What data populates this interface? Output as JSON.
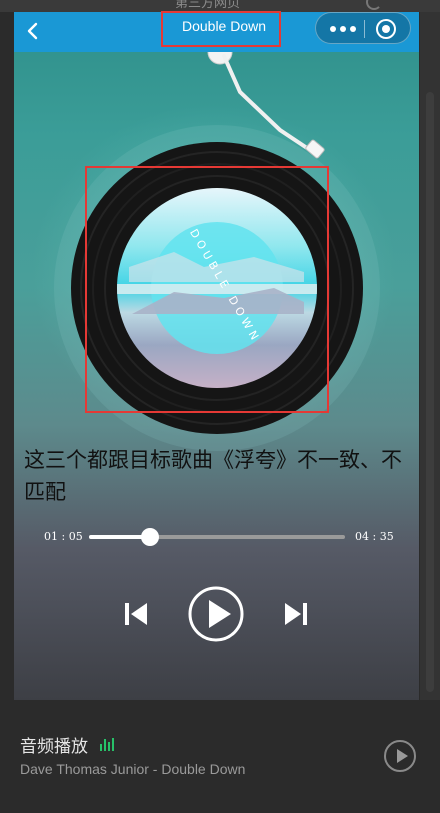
{
  "host": {
    "window_title": "第三方网页"
  },
  "navbar": {
    "title": "Double Down",
    "back_icon": "chevron-left-icon",
    "menu_icon": "more-dots-icon",
    "close_icon": "target-circle-icon"
  },
  "player": {
    "lyric_note": "这三个都跟目标歌曲《浮夸》不一致、不匹配",
    "current_time": "01 : 05",
    "total_time": "04 : 35",
    "progress": 0.24,
    "controls": {
      "prev_icon": "skip-previous-icon",
      "play_icon": "play-circle-icon",
      "next_icon": "skip-next-icon"
    },
    "cover_text": "DOUBLE DOWN"
  },
  "audio_bar": {
    "title": "音频播放",
    "subtitle": "Dave Thomas Junior - Double Down",
    "eq_icon": "equalizer-icon",
    "play_icon": "play-circle-icon"
  },
  "colors": {
    "navbar": "#1a98d5",
    "annotation": "#e53935",
    "eq_green": "#27c068"
  }
}
